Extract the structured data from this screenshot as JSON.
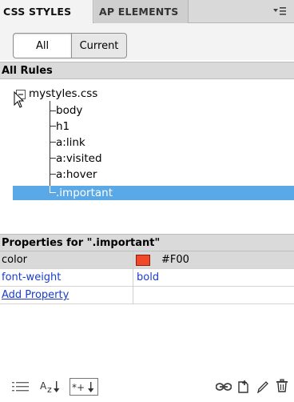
{
  "tabs": [
    {
      "label": "CSS STYLES",
      "active": true
    },
    {
      "label": "AP ELEMENTS",
      "active": false
    }
  ],
  "mode_toggle": {
    "all_label": "All",
    "current_label": "Current",
    "selected": "All"
  },
  "rules_section": {
    "title": "All Rules"
  },
  "tree": {
    "file": "mystyles.css",
    "rules": [
      "body",
      "h1",
      "a:link",
      "a:visited",
      "a:hover",
      ".important"
    ],
    "selected": ".important"
  },
  "properties": {
    "header": "Properties for \".important\"",
    "rows": [
      {
        "name": "color",
        "value": "#F00",
        "swatch": "#f2482a"
      },
      {
        "name": "font-weight",
        "value": "bold"
      }
    ],
    "add_property": "Add Property"
  },
  "toolbar": {
    "left_icons": [
      "category-view-icon",
      "alphabetical-view-icon",
      "set-properties-view-icon"
    ],
    "right_icons": [
      "attach-stylesheet-icon",
      "new-rule-icon",
      "edit-rule-icon",
      "delete-rule-icon"
    ]
  },
  "colors": {
    "selection": "#5aa9e6",
    "link": "#1a3dc8",
    "header_bg": "#dadada"
  }
}
